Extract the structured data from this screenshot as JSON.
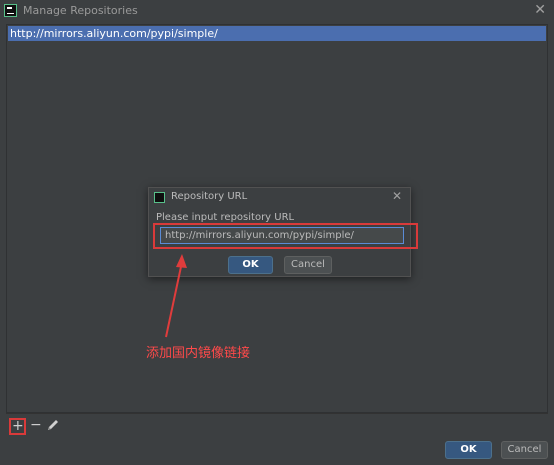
{
  "window": {
    "title": "Manage Repositories"
  },
  "repositories": [
    "http://mirrors.aliyun.com/pypi/simple/"
  ],
  "toolbar": {
    "add_label": "+",
    "remove_label": "−"
  },
  "footer": {
    "ok_label": "OK",
    "cancel_label": "Cancel"
  },
  "dialog": {
    "title": "Repository URL",
    "prompt": "Please input repository URL",
    "input_value": "http://mirrors.aliyun.com/pypi/simple/",
    "ok_label": "OK",
    "cancel_label": "Cancel"
  },
  "annotation": {
    "text": "添加国内镜像链接",
    "color": "#ff4a4a"
  },
  "colors": {
    "selection": "#4b6eaf",
    "primary_button": "#365880",
    "highlight": "#d93a3a"
  }
}
